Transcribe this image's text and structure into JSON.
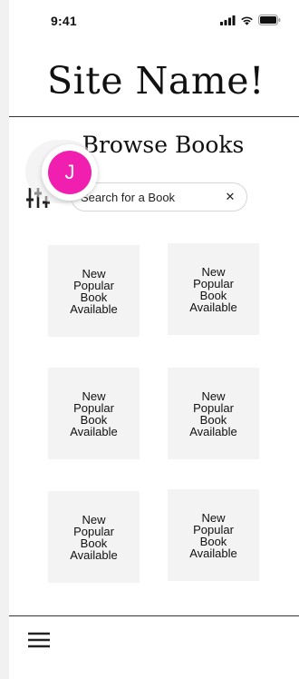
{
  "status_bar": {
    "time": "9:41",
    "icons": [
      "signal-icon",
      "wifi-icon",
      "battery-icon"
    ]
  },
  "header": {
    "site_name": "Site Name!"
  },
  "browse": {
    "title": "Browse Books"
  },
  "search": {
    "placeholder": "Search for a Book",
    "value": "",
    "clear_label": "✕"
  },
  "avatar": {
    "initial": "J",
    "color": "#f01fb0"
  },
  "books": [
    {
      "label": "New Popular Book Available"
    },
    {
      "label": "New Popular Book Available"
    },
    {
      "label": "New Popular Book Available"
    },
    {
      "label": "New Popular Book Available"
    },
    {
      "label": "New Popular Book Available"
    },
    {
      "label": "New Popular Book Available"
    }
  ],
  "nav": {
    "menu_icon": "hamburger-menu-icon"
  }
}
